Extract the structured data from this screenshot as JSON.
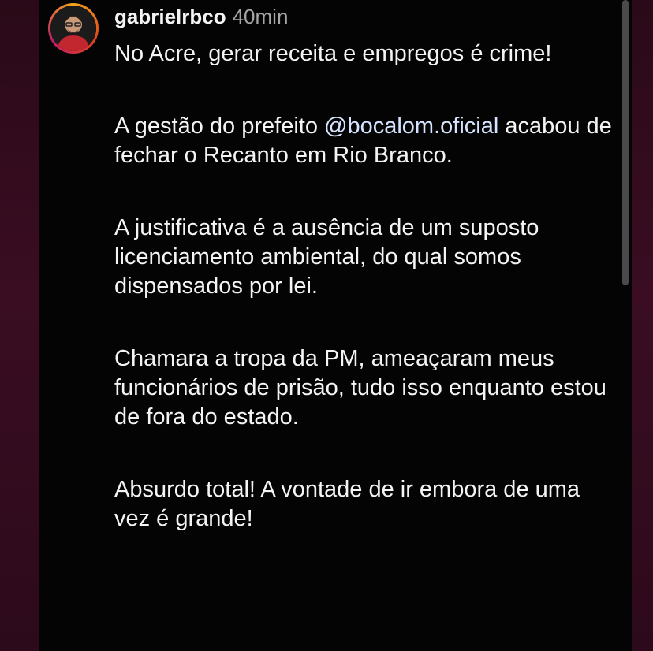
{
  "post": {
    "username": "gabrielrbco",
    "timestamp": "40min",
    "avatar_icon": "user-avatar",
    "paragraphs": {
      "p1": "No Acre, gerar receita e empregos é crime!",
      "p2_before": "A gestão do prefeito ",
      "p2_mention": "@bocalom.oficial",
      "p2_after": " acabou de fechar o Recanto em Rio Branco.",
      "p3": "A justificativa é a ausência de um suposto licenciamento ambiental, do qual somos dispensados por lei.",
      "p4": "Chamara a tropa da PM, ameaçaram meus funcionários de prisão, tudo isso enquanto estou de fora do estado.",
      "p5": "Absurdo total! A vontade de ir embora de uma vez é grande!"
    }
  },
  "colors": {
    "background": "#040404",
    "outer": "#2a0a18",
    "text": "#f4f4f4",
    "muted": "#a6a6a6"
  }
}
